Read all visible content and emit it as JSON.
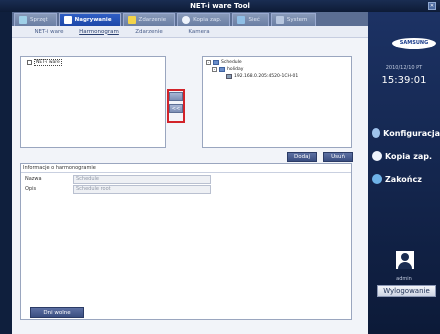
{
  "window": {
    "title": "NET-i ware Tool"
  },
  "tabs": [
    {
      "label": "Sprzęt",
      "active": false,
      "icon": "hardware-icon"
    },
    {
      "label": "Nagrywanie",
      "active": true,
      "icon": "record-icon"
    },
    {
      "label": "Zdarzenie",
      "active": false,
      "icon": "event-icon"
    },
    {
      "label": "Kopia zap.",
      "active": false,
      "icon": "backup-icon"
    },
    {
      "label": "Sieć",
      "active": false,
      "icon": "network-icon"
    },
    {
      "label": "System",
      "active": false,
      "icon": "system-icon"
    }
  ],
  "subnav": [
    "NET-i ware",
    "Harmonogram",
    "Zdarzenie",
    "Kamera"
  ],
  "left_tree": {
    "root": "NET-i ware"
  },
  "right_tree": {
    "root": "Schedule",
    "child": "holiday",
    "leaf": "192.168.0.205:4520-1CH-01"
  },
  "transfer": {
    "add": "",
    "remove": "<<"
  },
  "actions": {
    "add": "Dodaj",
    "delete": "Usuń"
  },
  "info": {
    "title": "Informacje o harmonogramie",
    "name_label": "Nazwa",
    "name_value": "Schedule",
    "desc_label": "Opis",
    "desc_value": "Schedule root",
    "days_off": "Dni wolne"
  },
  "sidebar": {
    "logo": "SAMSUNG",
    "date": "2010/12/10 PT",
    "time": "15:39:01",
    "buttons": [
      "Konfiguracja",
      "Kopia zap.",
      "Zakończ"
    ],
    "user": "admin",
    "logout": "Wylogowanie"
  },
  "colors": {
    "highlight": "#d2232a",
    "accent": "#1d47a8"
  }
}
